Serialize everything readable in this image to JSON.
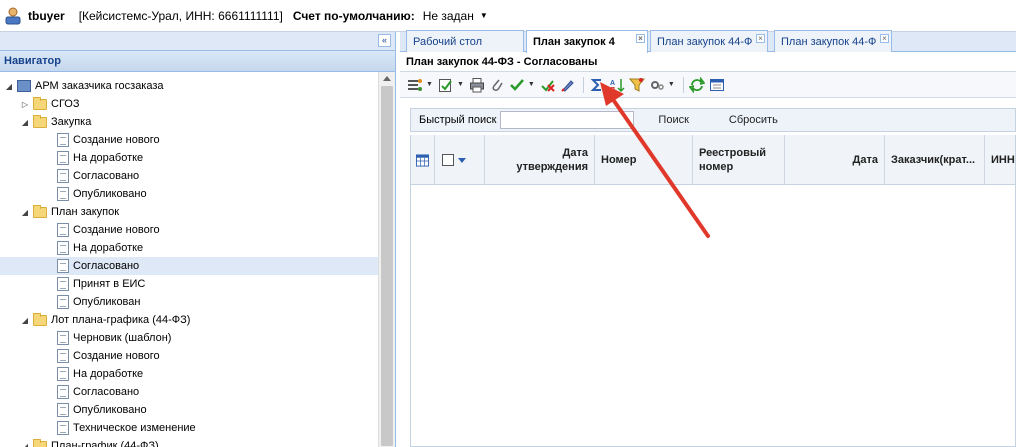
{
  "topbar": {
    "user_name": "tbuyer",
    "org": "[Кейсистемс-Урал, ИНН: 6661111111]",
    "account_label": "Счет по-умолчанию:",
    "account_value": "Не задан"
  },
  "navigator": {
    "title": "Навигатор",
    "collapse_glyph": "«",
    "items": [
      {
        "label": "АРМ заказчика госзаказа",
        "level": 0,
        "icon": "arm-icon",
        "toggle": "expanded"
      },
      {
        "label": "СГОЗ",
        "level": 1,
        "icon": "folder-icon",
        "toggle": "collapsed"
      },
      {
        "label": "Закупка",
        "level": 1,
        "icon": "folder-icon",
        "toggle": "expanded"
      },
      {
        "label": "Создание нового",
        "level": 2,
        "icon": "document-icon"
      },
      {
        "label": "На доработке",
        "level": 2,
        "icon": "document-icon"
      },
      {
        "label": "Согласовано",
        "level": 2,
        "icon": "document-icon"
      },
      {
        "label": "Опубликовано",
        "level": 2,
        "icon": "document-icon"
      },
      {
        "label": "План закупок",
        "level": 1,
        "icon": "folder-icon",
        "toggle": "expanded"
      },
      {
        "label": "Создание нового",
        "level": 2,
        "icon": "document-icon"
      },
      {
        "label": "На доработке",
        "level": 2,
        "icon": "document-icon"
      },
      {
        "label": "Согласовано",
        "level": 2,
        "icon": "document-icon",
        "selected": true
      },
      {
        "label": "Принят в ЕИС",
        "level": 2,
        "icon": "document-icon"
      },
      {
        "label": "Опубликован",
        "level": 2,
        "icon": "document-icon"
      },
      {
        "label": "Лот плана-графика (44-ФЗ)",
        "level": 1,
        "icon": "folder-icon",
        "toggle": "expanded"
      },
      {
        "label": "Черновик (шаблон)",
        "level": 2,
        "icon": "document-icon"
      },
      {
        "label": "Создание нового",
        "level": 2,
        "icon": "document-icon"
      },
      {
        "label": "На доработке",
        "level": 2,
        "icon": "document-icon"
      },
      {
        "label": "Согласовано",
        "level": 2,
        "icon": "document-icon"
      },
      {
        "label": "Опубликовано",
        "level": 2,
        "icon": "document-icon"
      },
      {
        "label": "Техническое изменение",
        "level": 2,
        "icon": "document-icon"
      },
      {
        "label": "План-график (44-ФЗ)",
        "level": 1,
        "icon": "folder-icon",
        "toggle": "expanded"
      }
    ]
  },
  "tabs": [
    {
      "label": "Рабочий стол",
      "active": false,
      "closable": false
    },
    {
      "label": "План закупок 4",
      "active": true,
      "closable": true
    },
    {
      "label": "План закупок 44-Ф",
      "active": false,
      "closable": true
    },
    {
      "label": "План закупок 44-Ф",
      "active": false,
      "closable": true
    }
  ],
  "panel": {
    "title": "План закупок 44-ФЗ - Согласованы"
  },
  "toolbar": {
    "icons": [
      "actions-icon",
      "approve-icon",
      "print-icon",
      "attach-icon",
      "check-icon",
      "reject-icon",
      "edit-icon",
      "sum-icon",
      "sort-icon",
      "filter-icon",
      "settings-icon",
      "refresh-icon",
      "export-icon"
    ]
  },
  "search": {
    "label": "Быстрый поиск",
    "value": "",
    "search_button": "Поиск",
    "reset_button": "Сбросить"
  },
  "grid": {
    "columns": [
      "Дата утверждения",
      "Номер",
      "Реестровый номер",
      "Дата",
      "Заказчик(крат...",
      "ИНН"
    ]
  },
  "colors": {
    "accent": "#15428b",
    "arrow": "#e0392b",
    "selected_row": "#dfe8f6"
  }
}
